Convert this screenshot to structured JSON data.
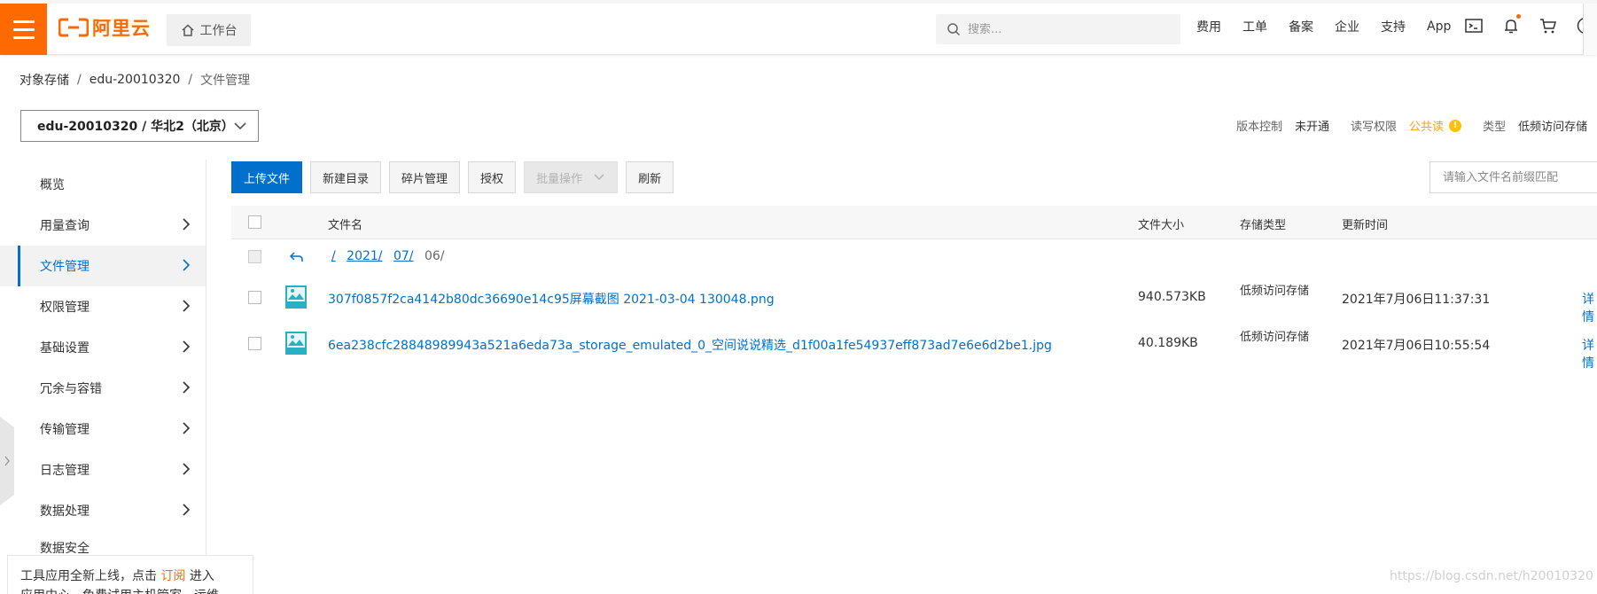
{
  "topbar": {
    "logo_text": "阿里云",
    "workbench_label": "工作台",
    "search_placeholder": "搜索...",
    "links": [
      "费用",
      "工单",
      "备案",
      "企业",
      "支持",
      "App"
    ],
    "brand_color": "#ff6a00"
  },
  "breadcrumb": [
    "对象存储",
    "edu-20010320",
    "文件管理"
  ],
  "bucket": {
    "selector_label": "edu-20010320 / 华北2（北京）",
    "version_key": "版本控制",
    "version_val": "未开通",
    "acl_key": "读写权限",
    "acl_val": "公共读",
    "type_key": "类型",
    "type_val": "低频访问存储"
  },
  "sidebar": {
    "items": [
      {
        "label": "概览"
      },
      {
        "label": "用量查询"
      },
      {
        "label": "文件管理"
      },
      {
        "label": "权限管理"
      },
      {
        "label": "基础设置"
      },
      {
        "label": "冗余与容错"
      },
      {
        "label": "传输管理"
      },
      {
        "label": "日志管理"
      },
      {
        "label": "数据处理"
      },
      {
        "label": "数据安全"
      }
    ],
    "active_index": 2
  },
  "promo": {
    "line1_before": "工具应用全新上线，点击 ",
    "line1_link": "订阅",
    "line1_after": " 进入",
    "line2": "应用中心，免费试用主机管家、运维"
  },
  "toolbar": {
    "upload": "上传文件",
    "new_dir": "新建目录",
    "fragments": "碎片管理",
    "authorize": "授权",
    "batch": "批量操作",
    "refresh": "刷新",
    "filter_placeholder": "请输入文件名前缀匹配"
  },
  "table": {
    "headers": {
      "name": "文件名",
      "size": "文件大小",
      "storage": "存储类型",
      "updated": "更新时间"
    },
    "path": {
      "root": "/",
      "seg1": "2021/",
      "seg2": "07/",
      "current": "06/"
    },
    "rows": [
      {
        "name": "307f0857f2ca4142b80dc36690e14c95屏幕截图 2021-03-04 130048.png",
        "size": "940.573KB",
        "storage": "低频访问存储",
        "updated": "2021年7月06日11:37:31",
        "action": "详情"
      },
      {
        "name": "6ea238cfc28848989943a521a6eda73a_storage_emulated_0_空间说说精选_d1f00a1fe54937eff873ad7e6e6d2be1.jpg",
        "size": "40.189KB",
        "storage": "低频访问存储",
        "updated": "2021年7月06日10:55:54",
        "action": "详情"
      }
    ]
  },
  "watermark": "https://blog.csdn.net/h20010320"
}
